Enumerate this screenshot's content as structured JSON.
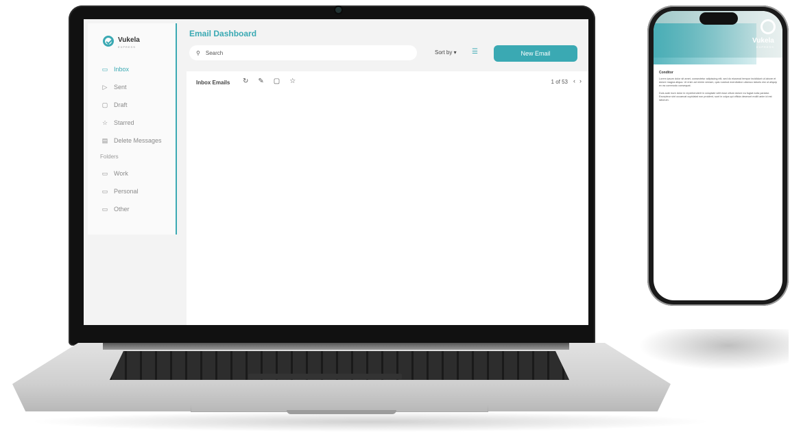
{
  "brand": {
    "name": "Vukela",
    "tagline": "EXPRESS",
    "accent": "#3aa9b3"
  },
  "app": {
    "title": "Email Dashboard",
    "search_placeholder": "Search",
    "sort_label": "Sort by",
    "new_email_label": "New Email",
    "panel_title": "Inbox Emails",
    "pager": "1 of 53"
  },
  "sidebar": {
    "items": [
      {
        "label": "Inbox",
        "icon": "inbox-icon"
      },
      {
        "label": "Sent",
        "icon": "send-icon"
      },
      {
        "label": "Draft",
        "icon": "draft-icon"
      },
      {
        "label": "Starred",
        "icon": "star-icon"
      },
      {
        "label": "Delete Messages",
        "icon": "trash-icon"
      }
    ],
    "folders_heading": "Folders",
    "folders": [
      {
        "label": "Work",
        "icon": "folder-icon"
      },
      {
        "label": "Personal",
        "icon": "folder-icon"
      },
      {
        "label": "Other",
        "icon": "folder-icon"
      }
    ]
  },
  "phone": {
    "heading": "Conditor",
    "para1": "Lorem ipsum dolor sit amet, consectetur adipiscing elit, sed do eiusmod tempor incididunt ut labore et dolore magna aliqua. Ut enim ad minim veniam, quis nostrud exercitation ullamco laboris nisi ut aliquip ex ea commodo consequat.",
    "para2": "Duis aute irure dolor in reprehenderit in voluptate velit esse cillum dolore eu fugiat nulla pariatur. Excepteur sint occaecat cupidatat non proident, sunt in culpa qui officia deserunt mollit anim id est laborum."
  }
}
